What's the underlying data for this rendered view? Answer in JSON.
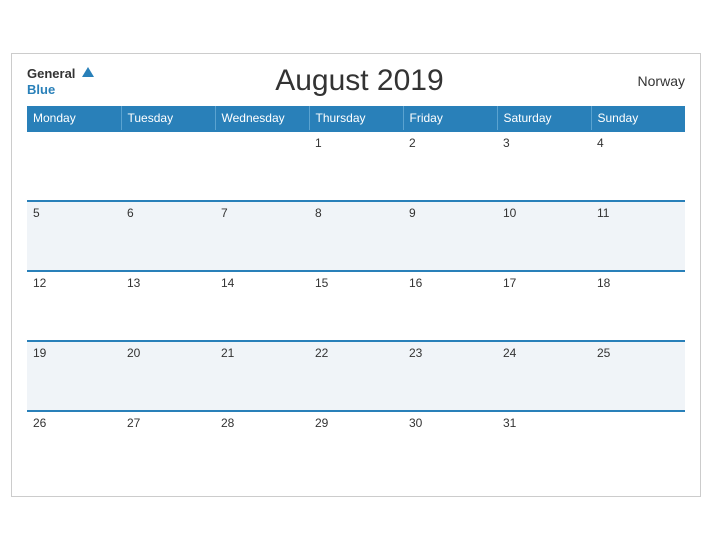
{
  "header": {
    "logo_general": "General",
    "logo_blue": "Blue",
    "title": "August 2019",
    "country": "Norway"
  },
  "weekdays": [
    "Monday",
    "Tuesday",
    "Wednesday",
    "Thursday",
    "Friday",
    "Saturday",
    "Sunday"
  ],
  "weeks": [
    [
      null,
      null,
      null,
      1,
      2,
      3,
      4
    ],
    [
      5,
      6,
      7,
      8,
      9,
      10,
      11
    ],
    [
      12,
      13,
      14,
      15,
      16,
      17,
      18
    ],
    [
      19,
      20,
      21,
      22,
      23,
      24,
      25
    ],
    [
      26,
      27,
      28,
      29,
      30,
      31,
      null
    ]
  ]
}
